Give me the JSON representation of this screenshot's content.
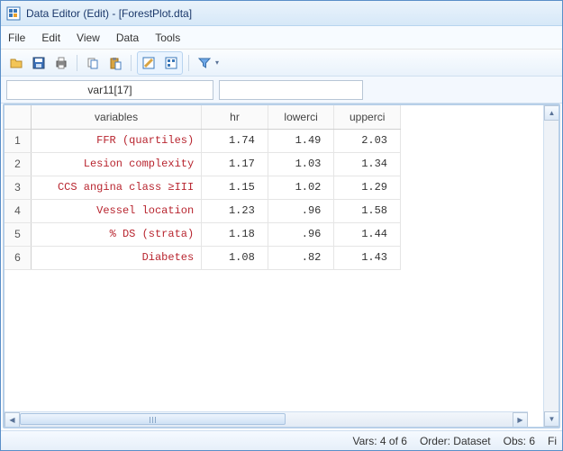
{
  "window": {
    "title": "Data Editor (Edit) - [ForestPlot.dta]"
  },
  "menu": [
    "File",
    "Edit",
    "View",
    "Data",
    "Tools"
  ],
  "toolbar": {
    "icons": [
      {
        "name": "open-icon"
      },
      {
        "name": "save-icon"
      },
      {
        "name": "print-icon"
      },
      {
        "sep": true
      },
      {
        "name": "copy-icon"
      },
      {
        "name": "paste-icon"
      },
      {
        "sep": true
      },
      {
        "group": [
          {
            "name": "edit-mode-icon"
          },
          {
            "name": "browse-mode-icon"
          }
        ]
      },
      {
        "sep": true
      },
      {
        "name": "filter-icon",
        "dropdown": true
      }
    ]
  },
  "addr": {
    "varcell": "var11[17]",
    "value": ""
  },
  "columns": [
    {
      "key": "variables",
      "label": "variables",
      "cls": "colvar"
    },
    {
      "key": "hr",
      "label": "hr",
      "cls": "colnum"
    },
    {
      "key": "lowerci",
      "label": "lowerci",
      "cls": "colnum"
    },
    {
      "key": "upperci",
      "label": "upperci",
      "cls": "colnum"
    }
  ],
  "rows": [
    {
      "n": "1",
      "variables": "FFR (quartiles)",
      "hr": "1.74",
      "lowerci": "1.49",
      "upperci": "2.03"
    },
    {
      "n": "2",
      "variables": "Lesion complexity",
      "hr": "1.17",
      "lowerci": "1.03",
      "upperci": "1.34"
    },
    {
      "n": "3",
      "variables": "CCS angina class ≥III",
      "hr": "1.15",
      "lowerci": "1.02",
      "upperci": "1.29"
    },
    {
      "n": "4",
      "variables": "Vessel location",
      "hr": "1.23",
      "lowerci": ".96",
      "upperci": "1.58"
    },
    {
      "n": "5",
      "variables": "% DS (strata)",
      "hr": "1.18",
      "lowerci": ".96",
      "upperci": "1.44"
    },
    {
      "n": "6",
      "variables": "Diabetes",
      "hr": "1.08",
      "lowerci": ".82",
      "upperci": "1.43"
    }
  ],
  "status": {
    "vars": "Vars: 4 of 6",
    "order": "Order: Dataset",
    "obs": "Obs: 6",
    "filter": "Fi"
  }
}
